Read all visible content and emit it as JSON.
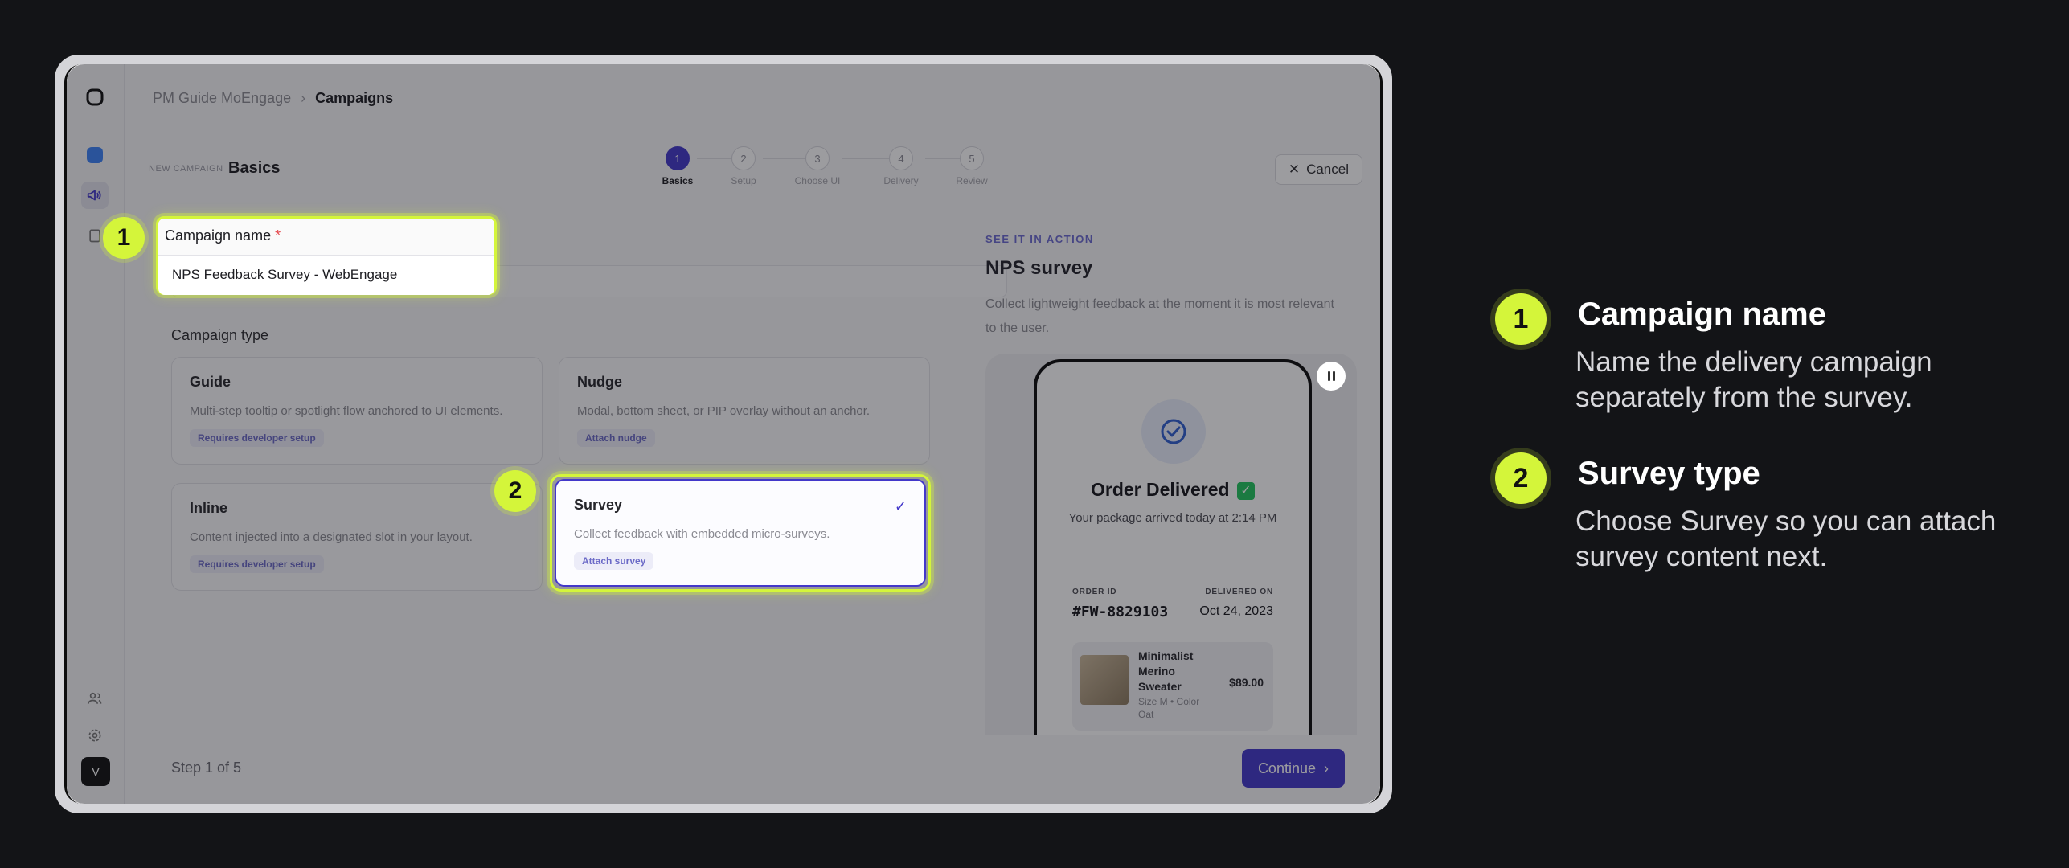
{
  "breadcrumb": {
    "workspace": "PM Guide MoEngage",
    "current": "Campaigns"
  },
  "header": {
    "kicker": "NEW CAMPAIGN",
    "title": "Basics",
    "cancel_label": "Cancel"
  },
  "stepper": [
    {
      "num": "1",
      "label": "Basics",
      "active": true
    },
    {
      "num": "2",
      "label": "Setup",
      "active": false
    },
    {
      "num": "3",
      "label": "Choose UI",
      "active": false
    },
    {
      "num": "4",
      "label": "Delivery",
      "active": false
    },
    {
      "num": "5",
      "label": "Review",
      "active": false
    }
  ],
  "form": {
    "name_label": "Campaign name",
    "required_mark": "*",
    "name_value": "NPS Feedback Survey - WebEngage",
    "type_label": "Campaign type",
    "types": [
      {
        "title": "Guide",
        "desc": "Multi-step tooltip or spotlight flow anchored to UI elements.",
        "tag": "Requires developer setup"
      },
      {
        "title": "Nudge",
        "desc": "Modal, bottom sheet, or PIP overlay without an anchor.",
        "tag": "Attach nudge"
      },
      {
        "title": "Inline",
        "desc": "Content injected into a designated slot in your layout.",
        "tag": "Requires developer setup"
      },
      {
        "title": "Survey",
        "desc": "Collect feedback with embedded micro-surveys.",
        "tag": "Attach survey",
        "selected": true
      }
    ]
  },
  "preview": {
    "kicker": "SEE IT IN ACTION",
    "title": "NPS survey",
    "desc": "Collect lightweight feedback at the moment it is most relevant to the user.",
    "order_title": "Order Delivered",
    "order_sub": "Your package arrived today at 2:14 PM",
    "order_id_label": "ORDER ID",
    "order_id": "#FW-8829103",
    "delivered_label": "DELIVERED ON",
    "delivered_value": "Oct 24, 2023",
    "product_name": "Minimalist Merino Sweater",
    "product_variant": "Size M • Color Oat",
    "product_price": "$89.00"
  },
  "footer": {
    "step_text": "Step 1 of 5",
    "continue_label": "Continue"
  },
  "sidebar": {
    "avatar_initial": "V"
  },
  "annotations": [
    {
      "num": "1",
      "title": "Campaign name",
      "desc": "Name the delivery campaign separately from the survey."
    },
    {
      "num": "2",
      "title": "Survey type",
      "desc": "Choose Survey so you can attach survey content next."
    }
  ],
  "colors": {
    "accent": "#4338ca",
    "highlight": "#d4f53a",
    "background": "#131417"
  }
}
